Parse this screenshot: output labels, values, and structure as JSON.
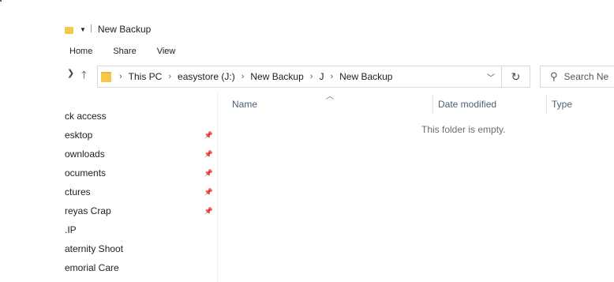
{
  "titlebar": {
    "title": "New Backup"
  },
  "ribbon": {
    "tabs": [
      "Home",
      "Share",
      "View"
    ]
  },
  "address": {
    "crumbs": [
      "This PC",
      "easystore (J:)",
      "New Backup",
      "J",
      "New Backup"
    ]
  },
  "search": {
    "placeholder": "Search Ne"
  },
  "nav_pane": {
    "items": [
      {
        "label": "ck access",
        "pinned": false
      },
      {
        "label": "esktop",
        "pinned": true
      },
      {
        "label": "ownloads",
        "pinned": true
      },
      {
        "label": "ocuments",
        "pinned": true
      },
      {
        "label": "ctures",
        "pinned": true
      },
      {
        "label": "reyas Crap",
        "pinned": true
      },
      {
        "label": ".IP",
        "pinned": false
      },
      {
        "label": "aternity Shoot",
        "pinned": false
      },
      {
        "label": "emorial Care",
        "pinned": false
      }
    ]
  },
  "columns": {
    "name": "Name",
    "date_modified": "Date modified",
    "type": "Type"
  },
  "content": {
    "empty_message": "This folder is empty."
  },
  "icons": {
    "folder_color": "#f3c94c",
    "pin": "pin-icon",
    "back": "up-arrow-icon",
    "refresh": "refresh-icon",
    "search": "search-icon"
  }
}
